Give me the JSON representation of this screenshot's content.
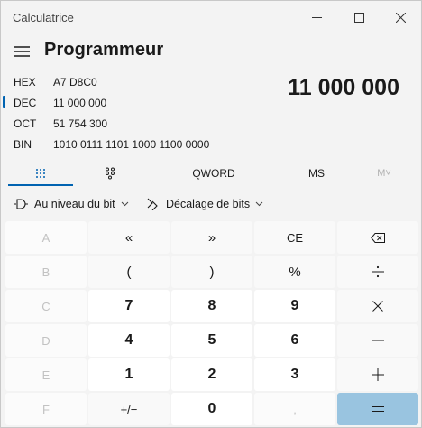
{
  "window": {
    "title": "Calculatrice"
  },
  "header": {
    "mode": "Programmeur"
  },
  "bases": [
    {
      "label": "HEX",
      "value": "A7 D8C0"
    },
    {
      "label": "DEC",
      "value": "11 000 000"
    },
    {
      "label": "OCT",
      "value": "51 754 300"
    },
    {
      "label": "BIN",
      "value": "1010 0111 1101 1000 1100 0000"
    }
  ],
  "display": {
    "value": "11 000 000"
  },
  "tabs": {
    "word_size": "QWORD",
    "memory_store": "MS",
    "memory_list": "M˅"
  },
  "toolbar": {
    "bitwise": "Au niveau du bit",
    "bitshift": "Décalage de bits"
  },
  "keys": [
    [
      "A",
      "«",
      "»",
      "CE",
      "backspace"
    ],
    [
      "B",
      "(",
      ")",
      "%",
      "÷"
    ],
    [
      "C",
      "7",
      "8",
      "9",
      "×"
    ],
    [
      "D",
      "4",
      "5",
      "6",
      "−"
    ],
    [
      "E",
      "1",
      "2",
      "3",
      "+"
    ],
    [
      "F",
      "+/−",
      "0",
      ",",
      "="
    ]
  ],
  "key_labels": {
    "a": "A",
    "b": "B",
    "c": "C",
    "d": "D",
    "e": "E",
    "f": "F",
    "lshift": "«",
    "rshift": "»",
    "ce": "CE",
    "lparen": "(",
    "rparen": ")",
    "percent": "%",
    "n7": "7",
    "n8": "8",
    "n9": "9",
    "n4": "4",
    "n5": "5",
    "n6": "6",
    "n1": "1",
    "n2": "2",
    "n3": "3",
    "negate": "+/−",
    "n0": "0",
    "decimal": ","
  },
  "colors": {
    "accent": "#0063b1",
    "equals": "#99c4e0"
  }
}
